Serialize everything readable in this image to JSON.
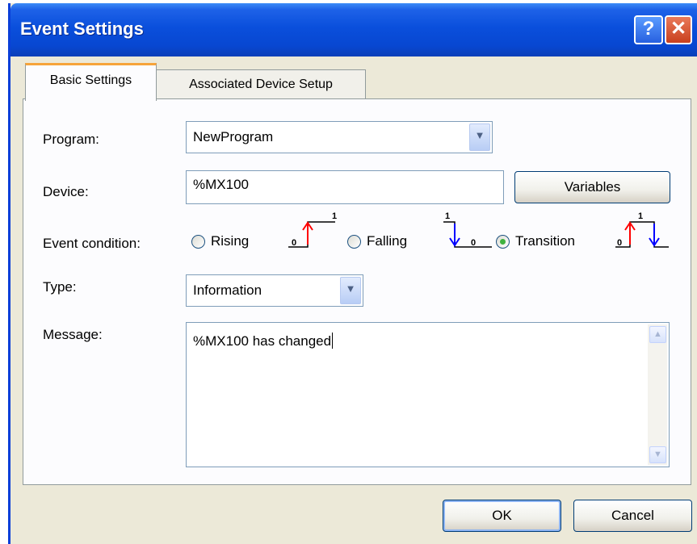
{
  "window": {
    "title": "Event Settings",
    "help_label": "?",
    "close_label": "✕"
  },
  "tabs": [
    {
      "label": "Basic Settings",
      "active": true
    },
    {
      "label": "Associated Device Setup",
      "active": false
    }
  ],
  "form": {
    "program": {
      "label": "Program:",
      "value": "NewProgram"
    },
    "device": {
      "label": "Device:",
      "value": "%MX100",
      "button_label": "Variables"
    },
    "event_condition": {
      "label": "Event condition:",
      "options": [
        {
          "label": "Rising",
          "selected": false
        },
        {
          "label": "Falling",
          "selected": false
        },
        {
          "label": "Transition",
          "selected": true
        }
      ],
      "signal_labels": {
        "low": "0",
        "high": "1"
      }
    },
    "type": {
      "label": "Type:",
      "value": "Information"
    },
    "message": {
      "label": "Message:",
      "value": "%MX100 has changed"
    }
  },
  "footer": {
    "ok_label": "OK",
    "cancel_label": "Cancel"
  },
  "colors": {
    "rising": "#ff0000",
    "falling": "#0000ff",
    "title_bar": "#0a4fdc",
    "tab_highlight": "#f6a43a"
  }
}
